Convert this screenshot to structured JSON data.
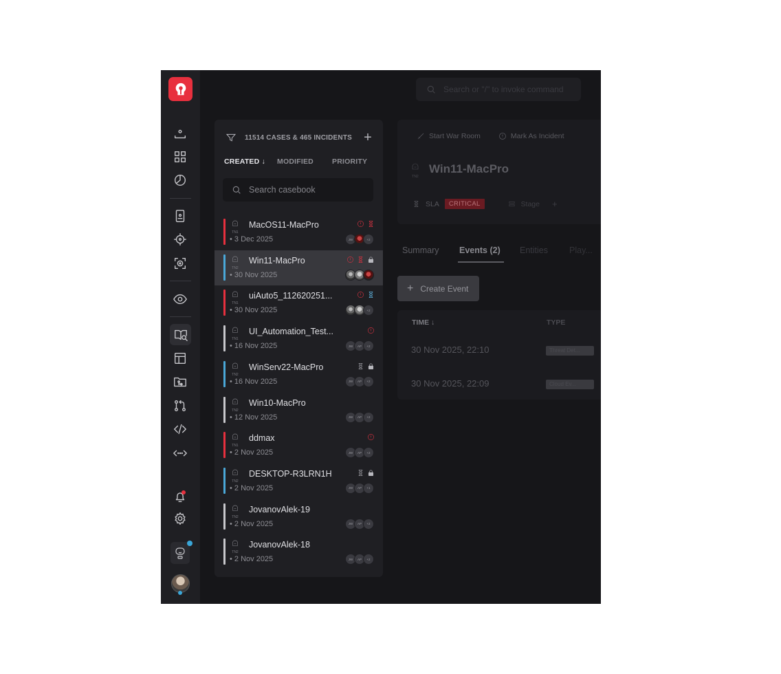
{
  "search": {
    "placeholder": "Search or \"/\" to invoke command"
  },
  "rail": {
    "icons": [
      "home-icon",
      "grid-icon",
      "pie-chart-icon",
      "phone-contact-icon",
      "crosshair-icon",
      "target-scan-icon",
      "eye-icon",
      "casebook-icon",
      "layout-icon",
      "git-folder-icon",
      "pull-request-icon",
      "code-icon",
      "api-icon",
      "bell-icon",
      "gear-icon",
      "bot-icon",
      "avatar"
    ]
  },
  "casebook": {
    "count_label": "11514 CASES & 465 INCIDENTS",
    "sort_tabs": [
      "CREATED ↓",
      "MODIFIED",
      "PRIORITY"
    ],
    "search_placeholder": "Search casebook",
    "cases": [
      {
        "name": "MacOS11-MacPro",
        "date": "• 3 Dec 2025",
        "accent": "#e8303e",
        "badge": "TN1",
        "flags": [
          "alert",
          "sla-red"
        ],
        "avatars": [
          "JW",
          "photo3",
          "+2"
        ]
      },
      {
        "name": "Win11-MacPro",
        "date": "• 30 Nov 2025",
        "accent": "#4aa8d8",
        "badge": "TN2",
        "flags": [
          "alert",
          "sla-red",
          "lock"
        ],
        "avatars": [
          "photo",
          "photo2",
          "photo3"
        ]
      },
      {
        "name": "uiAuto5_112620251...",
        "date": "• 30 Nov 2025",
        "accent": "#e8303e",
        "badge": "TN1",
        "flags": [
          "alert",
          "sla-blue"
        ],
        "avatars": [
          "photo",
          "photo2",
          "+2"
        ]
      },
      {
        "name": "UI_Automation_Test...",
        "date": "• 16 Nov 2025",
        "accent": "#c8c8cc",
        "badge": "TN1",
        "flags": [
          "alert"
        ],
        "avatars": [
          "JW",
          "AP",
          "+2"
        ]
      },
      {
        "name": "WinServ22-MacPro",
        "date": "• 16 Nov 2025",
        "accent": "#4aa8d8",
        "badge": "TN2",
        "flags": [
          "sla-grey",
          "lock"
        ],
        "avatars": [
          "JW",
          "AP",
          "+2"
        ]
      },
      {
        "name": "Win10-MacPro",
        "date": "• 12 Nov 2025",
        "accent": "#c8c8cc",
        "badge": "TN2",
        "flags": [],
        "avatars": [
          "JW",
          "AP",
          "+2"
        ]
      },
      {
        "name": "ddmax",
        "date": "• 2 Nov 2025",
        "accent": "#e8303e",
        "badge": "TN1",
        "flags": [
          "alert"
        ],
        "avatars": [
          "JW",
          "AP",
          "+2"
        ]
      },
      {
        "name": "DESKTOP-R3LRN1H",
        "date": "• 2 Nov 2025",
        "accent": "#4aa8d8",
        "badge": "TN2",
        "flags": [
          "sla-grey",
          "lock"
        ],
        "avatars": [
          "JW",
          "AP",
          "+1"
        ]
      },
      {
        "name": "JovanovAlek-19",
        "date": "• 2 Nov 2025",
        "accent": "#c8c8cc",
        "badge": "TN2",
        "flags": [],
        "avatars": [
          "JW",
          "AP",
          "+2"
        ]
      },
      {
        "name": "JovanovAlek-18",
        "date": "• 2 Nov 2025",
        "accent": "#c8c8cc",
        "badge": "TN2",
        "flags": [],
        "avatars": [
          "JW",
          "AP",
          "+2"
        ]
      }
    ],
    "selected_index": 1
  },
  "detail": {
    "actions": [
      "Start War Room",
      "Mark As Incident"
    ],
    "badge": "TN2",
    "title": "Win11-MacPro",
    "sla_label": "SLA",
    "sla_status": "CRITICAL",
    "stage_label": "Stage",
    "tabs": [
      "Summary",
      "Events (2)",
      "Entities",
      "Play..."
    ],
    "active_tab": 1,
    "create_label": "Create Event",
    "events": {
      "time_header": "TIME ↓",
      "type_header": "TYPE",
      "rows": [
        {
          "time": "30 Nov 2025, 22:10",
          "type": "Threat Det..."
        },
        {
          "time": "30 Nov 2025, 22:09",
          "type": "Cloud Ev..."
        }
      ]
    }
  }
}
